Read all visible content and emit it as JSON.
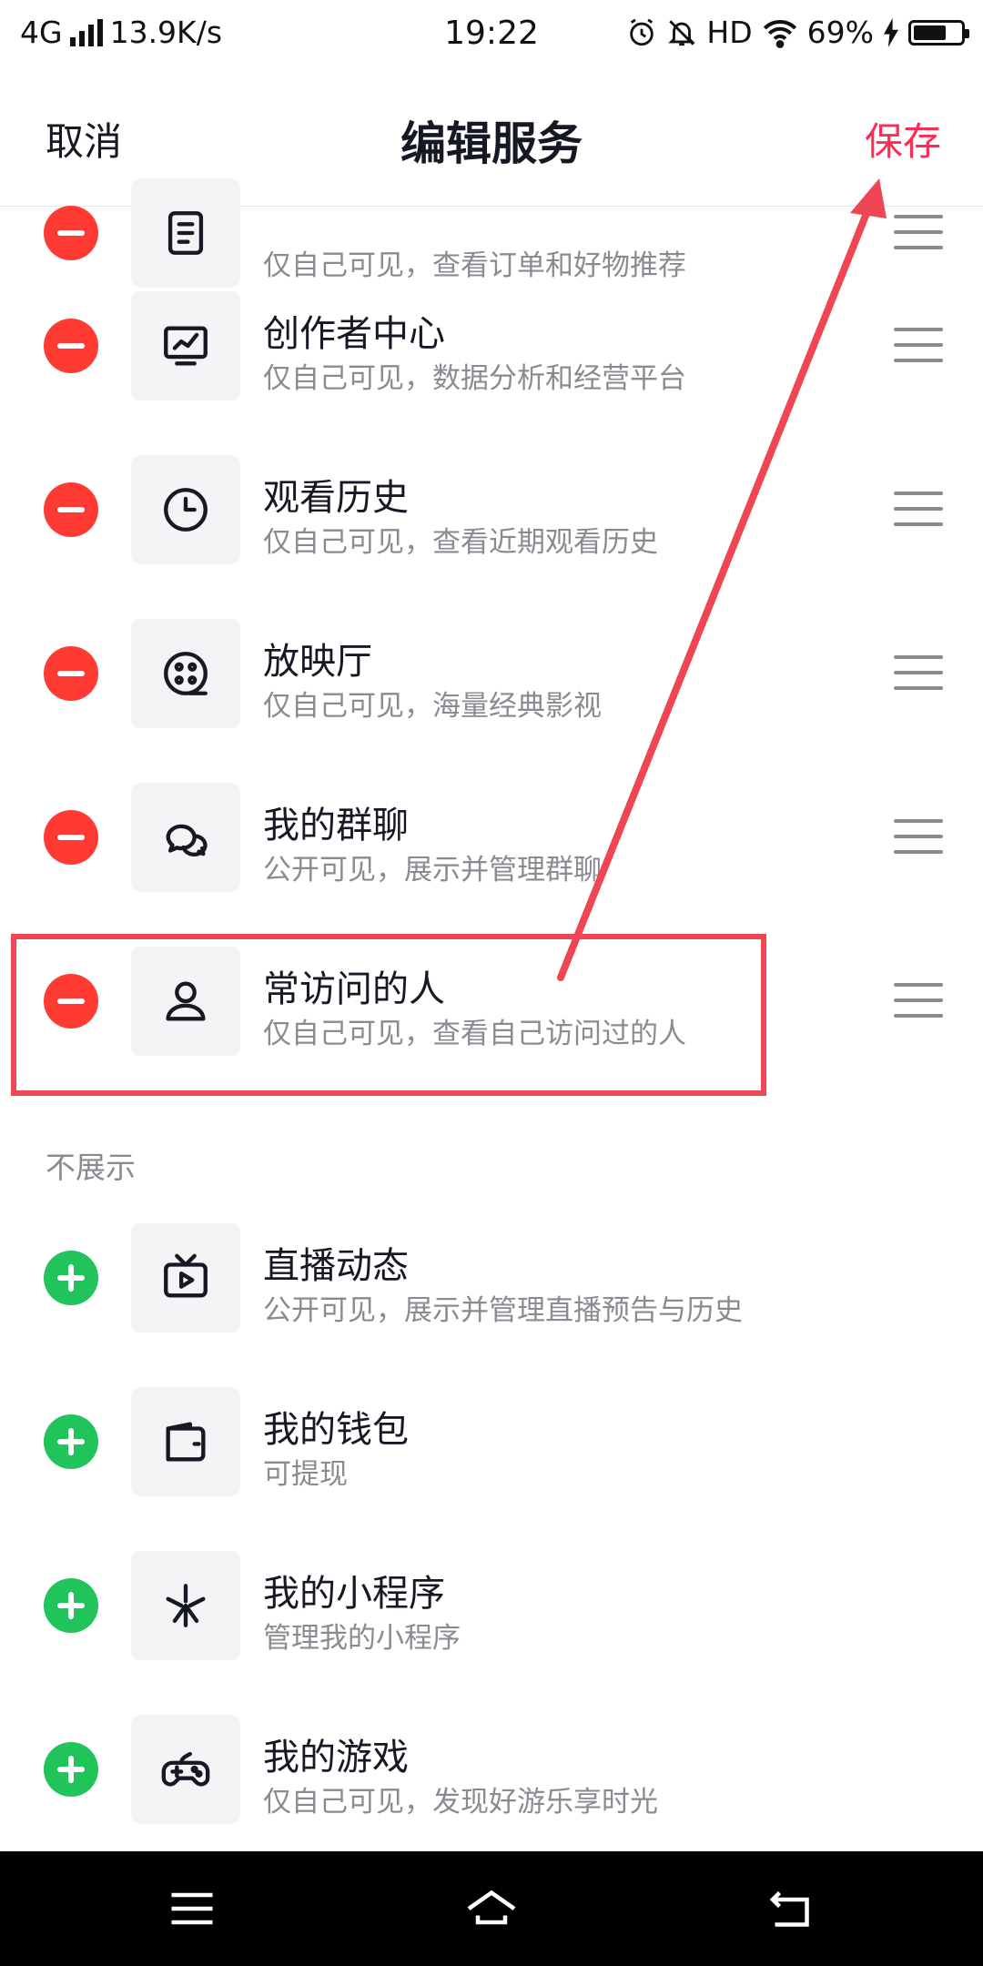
{
  "status_bar": {
    "network": "4G",
    "speed": "13.9K/s",
    "time": "19:22",
    "hd": "HD",
    "battery": "69%",
    "battery_level": 0.69
  },
  "header": {
    "cancel_label": "取消",
    "title": "编辑服务",
    "save_label": "保存"
  },
  "shown_items": [
    {
      "name": "",
      "desc": "仅自己可见，查看订单和好物推荐",
      "icon": "order-icon",
      "action": "remove"
    },
    {
      "name": "创作者中心",
      "desc": "仅自己可见，数据分析和经营平台",
      "icon": "chart-monitor-icon",
      "action": "remove"
    },
    {
      "name": "观看历史",
      "desc": "仅自己可见，查看近期观看历史",
      "icon": "clock-icon",
      "action": "remove"
    },
    {
      "name": "放映厅",
      "desc": "仅自己可见，海量经典影视",
      "icon": "film-reel-icon",
      "action": "remove"
    },
    {
      "name": "我的群聊",
      "desc": "公开可见，展示并管理群聊",
      "icon": "chat-bubbles-icon",
      "action": "remove"
    },
    {
      "name": "常访问的人",
      "desc": "仅自己可见，查看自己访问过的人",
      "icon": "person-icon",
      "action": "remove"
    }
  ],
  "hidden_section_label": "不展示",
  "hidden_items": [
    {
      "name": "直播动态",
      "desc": "公开可见，展示并管理直播预告与历史",
      "icon": "tv-play-icon",
      "action": "add"
    },
    {
      "name": "我的钱包",
      "desc": "可提现",
      "icon": "wallet-icon",
      "action": "add"
    },
    {
      "name": "我的小程序",
      "desc": "管理我的小程序",
      "icon": "mini-program-icon",
      "action": "add"
    },
    {
      "name": "我的游戏",
      "desc": "仅自己可见，发现好游乐享时光",
      "icon": "gamepad-icon",
      "action": "add"
    }
  ],
  "colors": {
    "accent": "#fe2c55",
    "remove": "#fe3a33",
    "add": "#21c35b",
    "annotation": "#ee4654"
  }
}
